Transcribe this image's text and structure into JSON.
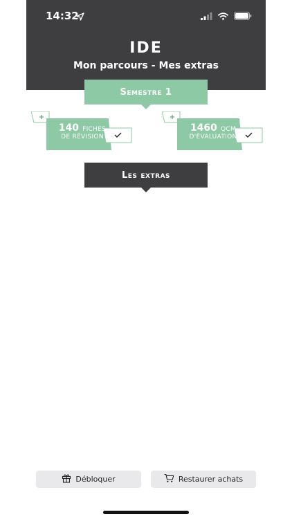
{
  "status_bar": {
    "time": "14:32"
  },
  "header": {
    "title": "IDE",
    "subtitle": "Mon parcours - Mes extras"
  },
  "semestre_banner": {
    "label": "Semestre 1"
  },
  "stats": [
    {
      "number": "140",
      "unit": "FICHES",
      "line2": "DE RÉVISION"
    },
    {
      "number": "1460",
      "unit": "QCM",
      "line2": "D'ÉVALUATION"
    }
  ],
  "extras_banner": {
    "label": "Les extras"
  },
  "bottom_buttons": {
    "unlock": "Débloquer",
    "restore": "Restaurer achats"
  },
  "colors": {
    "header_dark": "#3e3e40",
    "accent_green": "#8ec9a6",
    "button_grey": "#e9e9ec"
  }
}
